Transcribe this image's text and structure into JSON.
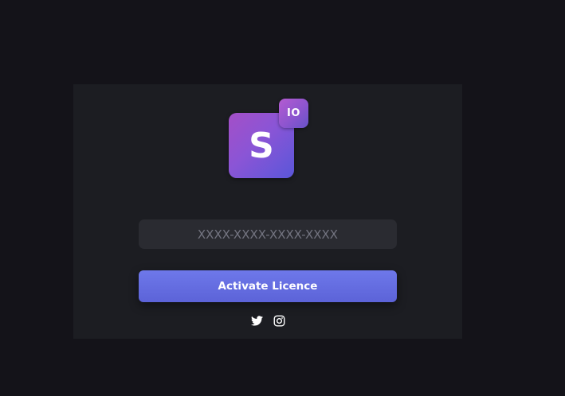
{
  "logo": {
    "letter": "S",
    "badge": "IO"
  },
  "licence_form": {
    "input_placeholder": "XXXX-XXXX-XXXX-XXXX",
    "input_value": "",
    "activate_label": "Activate Licence"
  },
  "socials": [
    {
      "icon": "twitter-icon"
    },
    {
      "icon": "instagram-icon"
    }
  ],
  "colors": {
    "background": "#141319",
    "card": "#1c1d22",
    "input_background": "#2a2b31",
    "button_accent": "#6670e3",
    "logo_gradient_start": "#a44fc7",
    "logo_gradient_end": "#5a56d9"
  }
}
